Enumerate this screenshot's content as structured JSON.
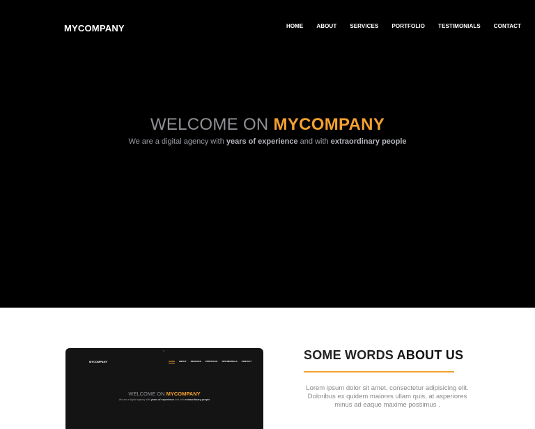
{
  "header": {
    "brand": "MYCOMPANY",
    "nav": [
      "HOME",
      "ABOUT",
      "SERVICES",
      "PORTFOLIO",
      "TESTIMONIALS",
      "CONTACT"
    ]
  },
  "hero": {
    "title_prefix": "WELCOME ON",
    "title_accent": "MYCOMPANY",
    "subtitle_1": "We are a digital agency with",
    "subtitle_bold_1": "years of experience",
    "subtitle_2": "and with",
    "subtitle_bold_2": "extraordinary people"
  },
  "about": {
    "title_prefix": "SOME WORDS",
    "title_bold": "ABOUT US",
    "text": "Lorem ipsum dolor sit amet, consectetur adipisicing elit. Doloribus ex quidem maiores ullam quis, at asperiores minus ad eaque maxime possimus ."
  },
  "colors": {
    "accent": "#f4a030",
    "hero_bg": "#000000",
    "muted_text": "#8f9196"
  }
}
